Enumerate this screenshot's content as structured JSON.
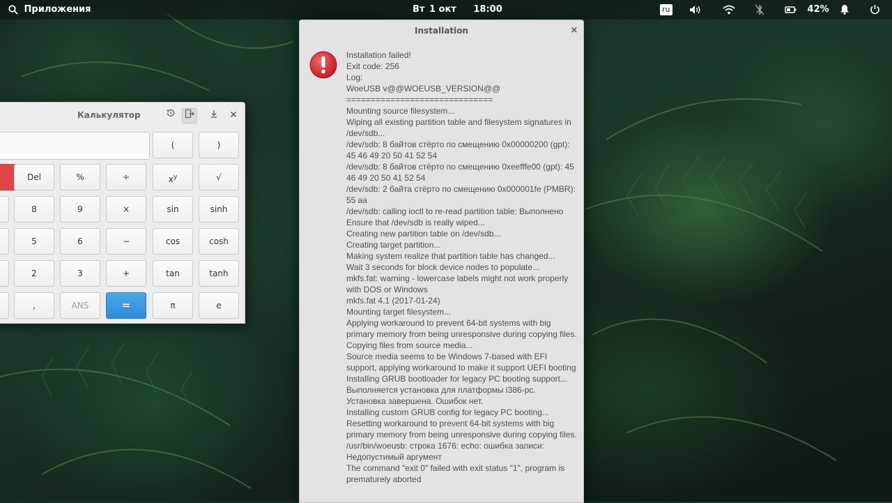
{
  "panel": {
    "apps_label": "Приложения",
    "day": "Вт",
    "date": "1 окт",
    "time": "18:00",
    "lang": "ru",
    "battery": "42%"
  },
  "calculator": {
    "title": "Калькулятор",
    "buttons": {
      "lparen": "(",
      "rparen": ")",
      "del": "Del",
      "percent": "%",
      "divide": "÷",
      "sqrt": "√",
      "n8": "8",
      "n9": "9",
      "multiply": "×",
      "sin": "sin",
      "sinh": "sinh",
      "n5": "5",
      "n6": "6",
      "minus": "−",
      "cos": "cos",
      "cosh": "cosh",
      "n2": "2",
      "n3": "3",
      "plus": "+",
      "tan": "tan",
      "tanh": "tanh",
      "decimal": ",",
      "ans": "ANS",
      "equals": "=",
      "pi": "π",
      "e": "e"
    },
    "power_base": "x",
    "power_exp": "y"
  },
  "dialog": {
    "title": "Installation",
    "close": "×",
    "lines": [
      "Installation failed!",
      "Exit code: 256",
      "Log:",
      "WoeUSB v@@WOEUSB_VERSION@@",
      "==============================",
      "Mounting source filesystem...",
      "Wiping all existing partition table and filesystem signatures in /dev/sdb...",
      "/dev/sdb: 8 байтов стёрто по смещению 0x00000200 (gpt): 45 46 49 20 50 41 52 54",
      "/dev/sdb: 8 байтов стёрто по смещению 0xeefffe00 (gpt): 45 46 49 20 50 41 52 54",
      "/dev/sdb: 2 байта стёрто по смещению 0x000001fe (PMBR): 55 aa",
      "/dev/sdb: calling ioctl to re-read partition table: Выполнено",
      "Ensure that /dev/sdb is really wiped...",
      "Creating new partition table on /dev/sdb...",
      "Creating target partition...",
      "Making system realize that partition table has changed...",
      "Wait 3 seconds for block device nodes to populate...",
      "mkfs.fat: warning - lowercase labels might not work properly with DOS or Windows",
      "mkfs.fat 4.1 (2017-01-24)",
      "Mounting target filesystem...",
      "Applying workaround to prevent 64-bit systems with big primary memory from being unresponsive during copying files.",
      "Copying files from source media...",
      "Source media seems to be Windows 7-based with EFI support, applying workaround to make it support UEFI booting",
      "Installing GRUB bootloader for legacy PC booting support...",
      "Выполняется установка для платформы i386-pc.",
      "Установка завершена. Ошибок нет.",
      "Installing custom GRUB config for legacy PC booting...",
      "Resetting workaround to prevent 64-bit systems with big primary memory from being unresponsive during copying files.",
      "/usr/bin/woeusb: строка 1676: echo: ошибка записи: Недопустимый аргумент",
      "The command \"exit 0\" failed with exit status \"1\", program is prematurely aborted"
    ]
  }
}
